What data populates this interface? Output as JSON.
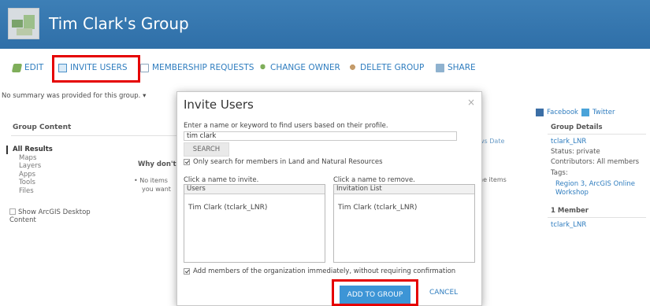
{
  "header": {
    "title": "Tim Clark's Group"
  },
  "toolbar": {
    "edit": "EDIT",
    "invite": "INVITE USERS",
    "membership": "MEMBERSHIP REQUESTS",
    "owner": "CHANGE OWNER",
    "delete": "DELETE GROUP",
    "share": "SHARE"
  },
  "summary": "No summary was provided for this group. ▾",
  "left": {
    "title": "Group Content",
    "all_results": "All Results",
    "items": [
      "Maps",
      "Layers",
      "Apps",
      "Tools",
      "Files"
    ],
    "show_arcgis_line1": "Show ArcGIS Desktop",
    "show_arcgis_line2": "Content"
  },
  "middle": {
    "why_dont": "Why don't",
    "no_items_line1": "• No items",
    "no_items_line2": "you want",
    "sort": "ws  Date",
    "items_fragment": "he items"
  },
  "right": {
    "facebook": "Facebook",
    "twitter": "Twitter",
    "details_title": "Group Details",
    "owner": "tclark_LNR",
    "status": "Status: private",
    "contributors": "Contributors: All members",
    "tags_label": "Tags:",
    "tag1_line1": "Region 3, ArcGIS Online",
    "tag1_line2": "Workshop",
    "members_title": "1 Member",
    "member": "tclark_LNR"
  },
  "modal": {
    "title": "Invite Users",
    "close": "×",
    "prompt": "Enter a name or keyword to find users based on their profile.",
    "search_value": "tim clark",
    "search_button": "SEARCH",
    "only_search": "Only search for members in Land and Natural Resources",
    "invite_label": "Click a name to invite.",
    "remove_label": "Click a name to remove.",
    "users_header": "Users",
    "invitation_header": "Invitation List",
    "user_item": "Tim Clark (tclark_LNR)",
    "invite_item": "Tim Clark (tclark_LNR)",
    "add_members": "Add members of the organization immediately, without requiring confirmation",
    "add_button": "ADD TO GROUP",
    "cancel_button": "CANCEL"
  },
  "colors": {
    "header_blue": "#2f6fa8",
    "link_blue": "#2f7dbf",
    "highlight_red": "#e50000",
    "primary_button": "#3d95d6"
  }
}
